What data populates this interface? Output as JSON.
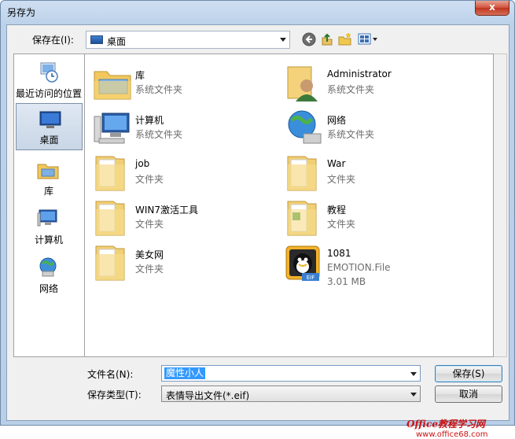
{
  "window": {
    "title": "另存为",
    "close_label": "x"
  },
  "toolbar": {
    "savein_label": "保存在(I):",
    "savein_value": "桌面"
  },
  "places": [
    {
      "label": "最近访问的位置",
      "icon": "recent-places-icon"
    },
    {
      "label": "桌面",
      "icon": "desktop-icon"
    },
    {
      "label": "库",
      "icon": "libraries-icon"
    },
    {
      "label": "计算机",
      "icon": "computer-icon"
    },
    {
      "label": "网络",
      "icon": "network-icon"
    }
  ],
  "files": [
    {
      "name": "库",
      "type": "系统文件夹",
      "icon": "libraries-folder-icon"
    },
    {
      "name": "Administrator",
      "type": "系统文件夹",
      "icon": "user-folder-icon"
    },
    {
      "name": "计算机",
      "type": "系统文件夹",
      "icon": "computer-icon"
    },
    {
      "name": "网络",
      "type": "系统文件夹",
      "icon": "network-icon"
    },
    {
      "name": "job",
      "type": "文件夹",
      "icon": "folder-icon"
    },
    {
      "name": "War",
      "type": "文件夹",
      "icon": "folder-icon"
    },
    {
      "name": "WIN7激活工具",
      "type": "文件夹",
      "icon": "folder-icon"
    },
    {
      "name": "教程",
      "type": "文件夹",
      "icon": "folder-icon"
    },
    {
      "name": "美女网",
      "type": "文件夹",
      "icon": "folder-icon"
    },
    {
      "name": "1081",
      "type": "EMOTION.File",
      "size": "3.01 MB",
      "icon": "qq-emotion-file-icon"
    }
  ],
  "form": {
    "filename_label": "文件名(N):",
    "filename_value": "魔性小人",
    "filetype_label": "保存类型(T):",
    "filetype_value": "表情导出文件(*.eif)",
    "save_label": "保存(S)",
    "cancel_label": "取消"
  },
  "watermark": {
    "line1": "Office教程学习网",
    "line2": "www.office68.com"
  }
}
